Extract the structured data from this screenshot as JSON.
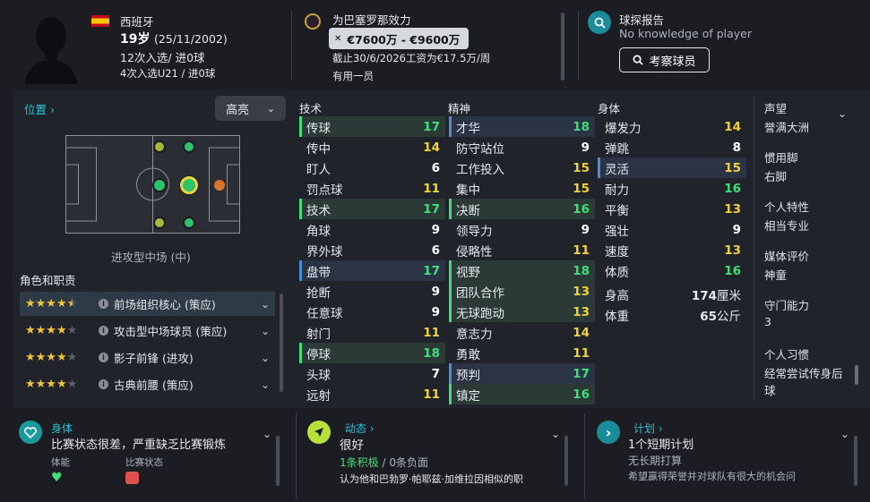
{
  "header": {
    "nationality": "西班牙",
    "age": "19岁",
    "dob": "(25/11/2002)",
    "caps": "12次入选/ 进0球",
    "u21_caps": "4次入选U21 / 进0球",
    "club": "为巴塞罗那效力",
    "value": "€7600万 - €9600万",
    "contract": "截止30/6/2026工资为€17.5万/周",
    "squad_status": "有用一员",
    "scout_title": "球探报告",
    "scout_sub": "No knowledge of player",
    "scout_button": "考察球员"
  },
  "position": {
    "title": "位置",
    "dropdown": "高亮",
    "position_label": "进攻型中场 (中)",
    "roles_title": "角色和职责",
    "roles": [
      {
        "stars": 4.5,
        "name": "前场组织核心 (策应)"
      },
      {
        "stars": 4,
        "name": "攻击型中场球员 (策应)"
      },
      {
        "stars": 4,
        "name": "影子前锋 (进攻)"
      },
      {
        "stars": 4,
        "name": "古典前腰 (策应)"
      }
    ]
  },
  "attributes": {
    "technical_title": "技术",
    "mental_title": "精神",
    "physical_title": "身体",
    "technical": [
      {
        "name": "传球",
        "value": "17",
        "hl": "green",
        "color": "green"
      },
      {
        "name": "传中",
        "value": "14",
        "hl": "",
        "color": "yellow"
      },
      {
        "name": "盯人",
        "value": "6",
        "hl": "",
        "color": "white"
      },
      {
        "name": "罚点球",
        "value": "11",
        "hl": "",
        "color": "yellow"
      },
      {
        "name": "技术",
        "value": "17",
        "hl": "green",
        "color": "green"
      },
      {
        "name": "角球",
        "value": "9",
        "hl": "",
        "color": "white"
      },
      {
        "name": "界外球",
        "value": "6",
        "hl": "",
        "color": "white"
      },
      {
        "name": "盘带",
        "value": "17",
        "hl": "blue",
        "color": "green"
      },
      {
        "name": "抢断",
        "value": "9",
        "hl": "",
        "color": "white"
      },
      {
        "name": "任意球",
        "value": "9",
        "hl": "",
        "color": "white"
      },
      {
        "name": "射门",
        "value": "11",
        "hl": "",
        "color": "yellow"
      },
      {
        "name": "停球",
        "value": "18",
        "hl": "green",
        "color": "green"
      },
      {
        "name": "头球",
        "value": "7",
        "hl": "",
        "color": "white"
      },
      {
        "name": "远射",
        "value": "11",
        "hl": "",
        "color": "yellow"
      }
    ],
    "mental": [
      {
        "name": "才华",
        "value": "18",
        "hl": "blue",
        "color": "green"
      },
      {
        "name": "防守站位",
        "value": "9",
        "hl": "",
        "color": "white"
      },
      {
        "name": "工作投入",
        "value": "15",
        "hl": "",
        "color": "yellow"
      },
      {
        "name": "集中",
        "value": "15",
        "hl": "",
        "color": "yellow"
      },
      {
        "name": "决断",
        "value": "16",
        "hl": "green",
        "color": "green"
      },
      {
        "name": "领导力",
        "value": "9",
        "hl": "",
        "color": "white"
      },
      {
        "name": "侵略性",
        "value": "11",
        "hl": "",
        "color": "yellow"
      },
      {
        "name": "视野",
        "value": "18",
        "hl": "green",
        "color": "green"
      },
      {
        "name": "团队合作",
        "value": "13",
        "hl": "green",
        "color": "yellow"
      },
      {
        "name": "无球跑动",
        "value": "13",
        "hl": "green",
        "color": "yellow"
      },
      {
        "name": "意志力",
        "value": "14",
        "hl": "",
        "color": "yellow"
      },
      {
        "name": "勇敢",
        "value": "11",
        "hl": "",
        "color": "yellow"
      },
      {
        "name": "预判",
        "value": "17",
        "hl": "blue",
        "color": "green"
      },
      {
        "name": "镇定",
        "value": "16",
        "hl": "green",
        "color": "green"
      }
    ],
    "physical": [
      {
        "name": "爆发力",
        "value": "14",
        "hl": "",
        "color": "yellow"
      },
      {
        "name": "弹跳",
        "value": "8",
        "hl": "",
        "color": "white"
      },
      {
        "name": "灵活",
        "value": "15",
        "hl": "blue",
        "color": "yellow"
      },
      {
        "name": "耐力",
        "value": "16",
        "hl": "",
        "color": "green"
      },
      {
        "name": "平衡",
        "value": "13",
        "hl": "",
        "color": "yellow"
      },
      {
        "name": "强壮",
        "value": "9",
        "hl": "",
        "color": "white"
      },
      {
        "name": "速度",
        "value": "13",
        "hl": "",
        "color": "yellow"
      },
      {
        "name": "体质",
        "value": "16",
        "hl": "",
        "color": "green"
      }
    ],
    "height_label": "身高",
    "height_value": "174",
    "height_unit": "厘米",
    "weight_label": "体重",
    "weight_value": "65",
    "weight_unit": "公斤"
  },
  "sidebar": {
    "reputation_label": "声望",
    "reputation_value": "誉满大洲",
    "foot_label": "惯用脚",
    "foot_value": "右脚",
    "personality_label": "个人特性",
    "personality_value": "相当专业",
    "media_label": "媒体评价",
    "media_value": "神童",
    "gk_label": "守门能力",
    "gk_value": "3",
    "habits_label": "个人习惯",
    "habits_value": "经常尝试传身后球"
  },
  "bottom": {
    "fitness_title": "身体",
    "fitness_text": "比赛状态很差，严重缺乏比赛锻炼",
    "condition_label": "体能",
    "match_label": "比赛状态",
    "dynamics_title": "动态",
    "dynamics_value": "很好",
    "positive": "1条积极",
    "negative": "/ 0条负面",
    "dynamics_note": "认为他和巴勃罗·帕耶兹·加维拉因相似的职",
    "plans_title": "计划",
    "plans_value": "1个短期计划",
    "plans_long": "无长期打算",
    "plans_note": "希望赢得荣誉并对球队有很大的机会问"
  },
  "colors": {
    "green": "#3ee07a",
    "yellow": "#f0d33a",
    "accent": "#27c3dc",
    "blue_hl": "#4d8fd6"
  }
}
